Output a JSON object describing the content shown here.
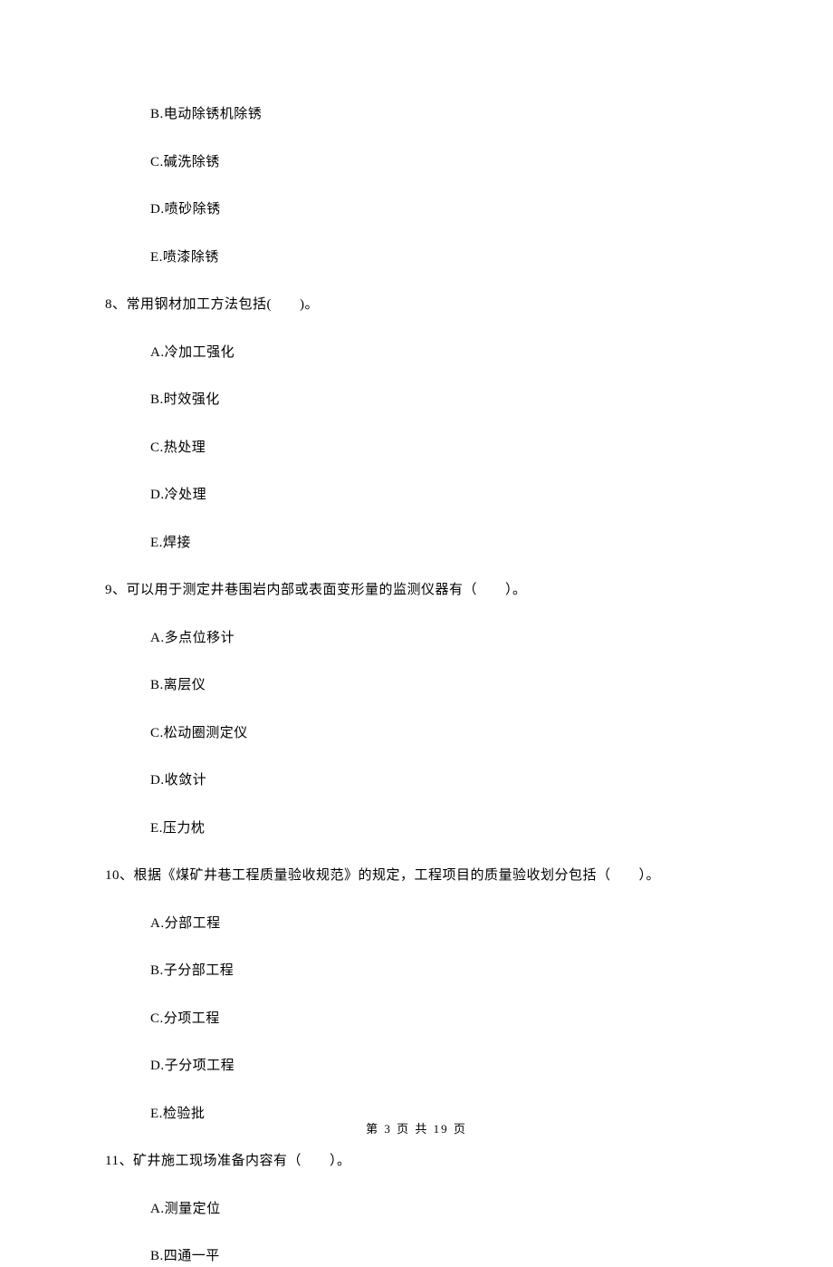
{
  "q7": {
    "options": {
      "B": "B.电动除锈机除锈",
      "C": "C.碱洗除锈",
      "D": "D.喷砂除锈",
      "E": "E.喷漆除锈"
    }
  },
  "q8": {
    "stem": "8、常用钢材加工方法包括(　　)。",
    "options": {
      "A": "A.冷加工强化",
      "B": "B.时效强化",
      "C": "C.热处理",
      "D": "D.冷处理",
      "E": "E.焊接"
    }
  },
  "q9": {
    "stem": "9、可以用于测定井巷围岩内部或表面变形量的监测仪器有（　　）。",
    "options": {
      "A": "A.多点位移计",
      "B": "B.离层仪",
      "C": "C.松动圈测定仪",
      "D": "D.收敛计",
      "E": "E.压力枕"
    }
  },
  "q10": {
    "stem": "10、根据《煤矿井巷工程质量验收规范》的规定，工程项目的质量验收划分包括（　　）。",
    "options": {
      "A": "A.分部工程",
      "B": "B.子分部工程",
      "C": "C.分项工程",
      "D": "D.子分项工程",
      "E": "E.检验批"
    }
  },
  "q11": {
    "stem": "11、矿井施工现场准备内容有（　　）。",
    "options": {
      "A": "A.测量定位",
      "B": "B.四通一平"
    }
  },
  "footer": "第 3 页 共 19 页"
}
